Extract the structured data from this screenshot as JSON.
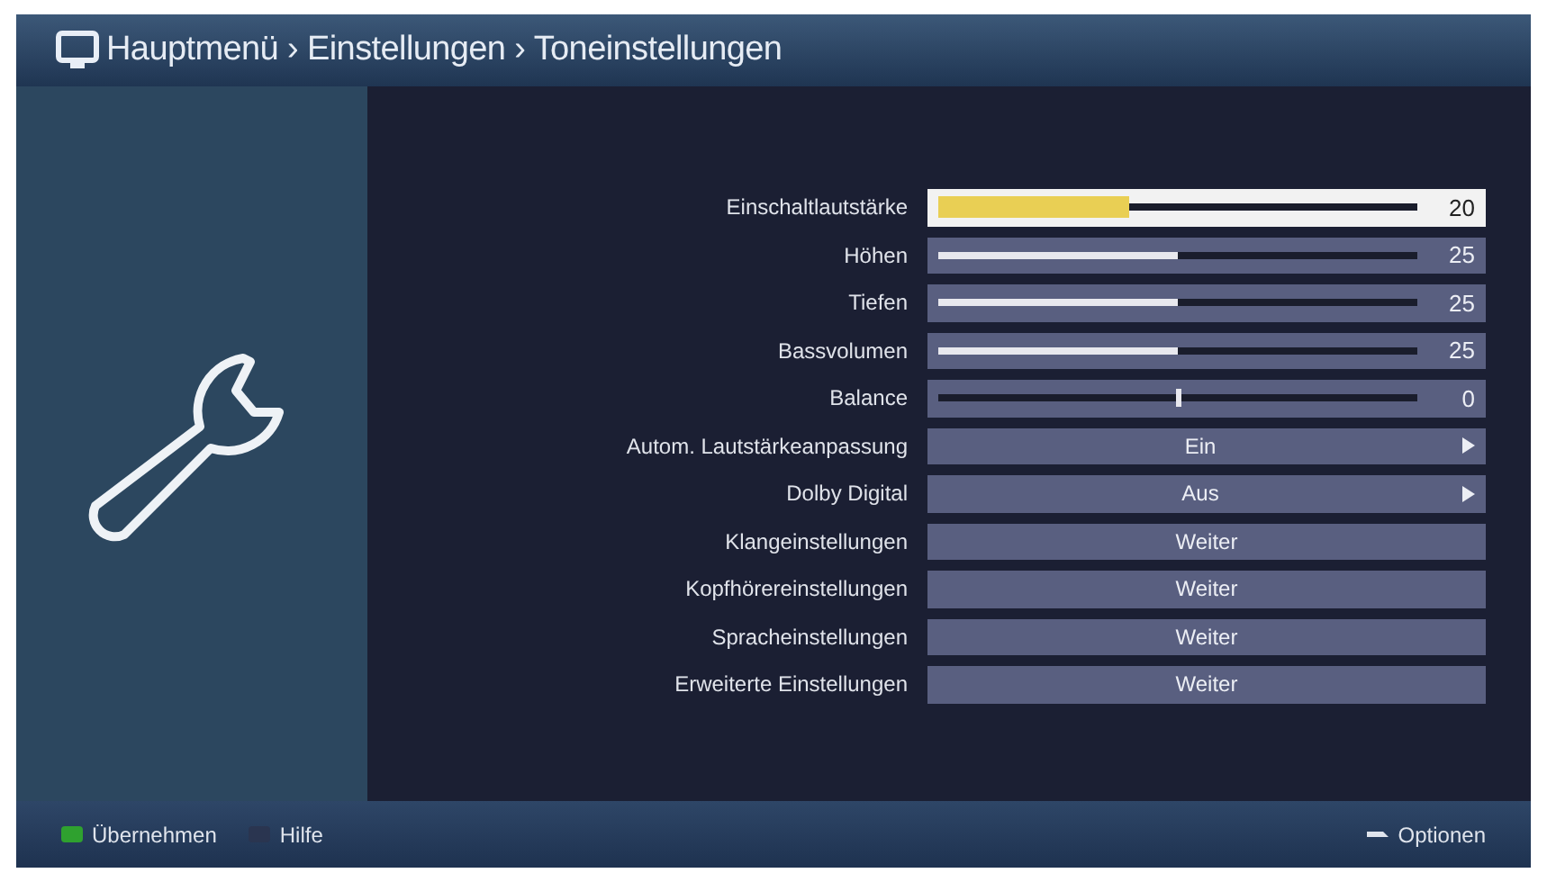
{
  "header": {
    "breadcrumb": "Hauptmenü › Einstellungen › Toneinstellungen"
  },
  "settings": [
    {
      "kind": "slider",
      "label": "Einschaltlautstärke",
      "level": 0.4,
      "value": "20",
      "selected": true
    },
    {
      "kind": "slider",
      "label": "Höhen",
      "level": 0.5,
      "value": "25",
      "selected": false
    },
    {
      "kind": "slider",
      "label": "Tiefen",
      "level": 0.5,
      "value": "25",
      "selected": false
    },
    {
      "kind": "slider",
      "label": "Bassvolumen",
      "level": 0.5,
      "value": "25",
      "selected": false
    },
    {
      "kind": "balance",
      "label": "Balance",
      "level": 0.5,
      "value": "0",
      "selected": false
    },
    {
      "kind": "select",
      "label": "Autom. Lautstärkeanpassung",
      "value": "Ein",
      "selected": false
    },
    {
      "kind": "select",
      "label": "Dolby Digital",
      "value": "Aus",
      "selected": false
    },
    {
      "kind": "link",
      "label": "Klangeinstellungen",
      "value": "Weiter",
      "selected": false
    },
    {
      "kind": "link",
      "label": "Kopfhörereinstellungen",
      "value": "Weiter",
      "selected": false
    },
    {
      "kind": "link",
      "label": "Spracheinstellungen",
      "value": "Weiter",
      "selected": false
    },
    {
      "kind": "link",
      "label": "Erweiterte Einstellungen",
      "value": "Weiter",
      "selected": false
    }
  ],
  "footer": {
    "left": [
      {
        "label": "Übernehmen",
        "color": "#2fa12f"
      },
      {
        "label": "Hilfe",
        "color": "#2a3550"
      }
    ],
    "right": {
      "label": "Optionen"
    }
  }
}
